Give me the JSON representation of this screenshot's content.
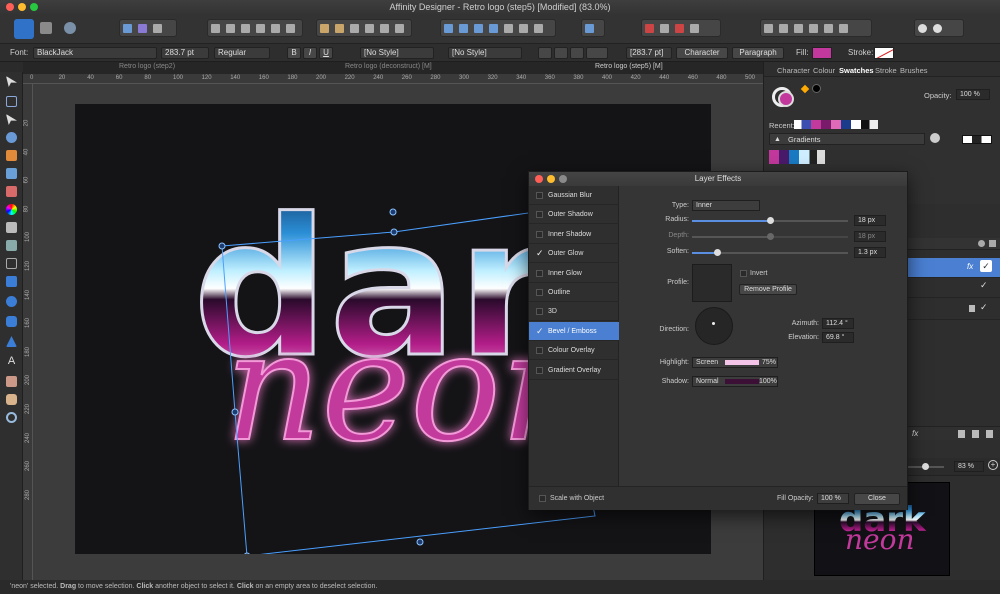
{
  "app": {
    "title": "Affinity Designer - Retro logo (step5) [Modified] (83.0%)"
  },
  "context_toolbar": {
    "font_label": "Font:",
    "font_name": "BlackJack",
    "font_size": "283.7 pt",
    "font_style": "Regular",
    "bold": "B",
    "italic": "I",
    "underline": "U",
    "char_style": "[No Style]",
    "para_style": "[No Style]",
    "size2": "[283.7 pt]",
    "character_button": "Character",
    "paragraph_button": "Paragraph",
    "fill_label": "Fill:",
    "stroke_label": "Stroke:",
    "fill_color": "#c2389c"
  },
  "doc_tabs": [
    "Retro logo (step2)",
    "Retro logo (deconstruct) [M]",
    "Retro logo (step5) [M]"
  ],
  "ruler_top": [
    "0",
    "20",
    "40",
    "60",
    "80",
    "100",
    "120",
    "140",
    "160",
    "180",
    "200",
    "220",
    "240",
    "260",
    "280",
    "300",
    "320",
    "340",
    "360",
    "380",
    "400",
    "420",
    "440",
    "460",
    "480",
    "500",
    "520",
    "540"
  ],
  "ruler_left": [
    "20",
    "40",
    "60",
    "80",
    "100",
    "120",
    "140",
    "160",
    "180",
    "200",
    "220",
    "240",
    "260",
    "280"
  ],
  "panel": {
    "tabs": [
      "Character",
      "Colour",
      "Swatches",
      "Stroke",
      "Brushes"
    ],
    "active_tab": "Swatches",
    "opacity_label": "Opacity:",
    "opacity_value": "100 %",
    "recent_label": "Recent:",
    "gradients_label": "Gradients"
  },
  "dialog": {
    "title": "Layer Effects",
    "effects": [
      {
        "label": "Gaussian Blur",
        "checked": false,
        "selected": false
      },
      {
        "label": "Outer Shadow",
        "checked": false,
        "selected": false
      },
      {
        "label": "Inner Shadow",
        "checked": false,
        "selected": false
      },
      {
        "label": "Outer Glow",
        "checked": true,
        "selected": false
      },
      {
        "label": "Inner Glow",
        "checked": false,
        "selected": false
      },
      {
        "label": "Outline",
        "checked": false,
        "selected": false
      },
      {
        "label": "3D",
        "checked": false,
        "selected": false
      },
      {
        "label": "Bevel / Emboss",
        "checked": true,
        "selected": true
      },
      {
        "label": "Colour Overlay",
        "checked": false,
        "selected": false
      },
      {
        "label": "Gradient Overlay",
        "checked": false,
        "selected": false
      }
    ],
    "type_label": "Type:",
    "type_value": "Inner",
    "radius_label": "Radius:",
    "radius_value": "18 px",
    "radius_fraction": 0.5,
    "depth_label": "Depth:",
    "depth_value": "18 px",
    "depth_fraction": 0.5,
    "soften_label": "Soften:",
    "soften_value": "1.3 px",
    "soften_fraction": 0.16,
    "profile_label": "Profile:",
    "invert_label": "Invert",
    "remove_profile": "Remove Profile",
    "direction_label": "Direction:",
    "azimuth_label": "Azimuth:",
    "azimuth_value": "112.4 °",
    "elevation_label": "Elevation:",
    "elevation_value": "69.8 °",
    "highlight_label": "Highlight:",
    "highlight_mode": "Screen",
    "highlight_pct": "75%",
    "highlight_color": "#f3c3e8",
    "shadow_label": "Shadow:",
    "shadow_mode": "Normal",
    "shadow_pct": "100%",
    "shadow_color": "#3c0f36",
    "scale_label": "Scale with Object",
    "fill_opacity_label": "Fill Opacity:",
    "fill_opacity_value": "100 %",
    "close_button": "Close"
  },
  "navigator": {
    "zoom": "83 %"
  },
  "art": {
    "word1": "dark",
    "word2": "neon"
  },
  "status": {
    "prefix": "'neon' selected. ",
    "b1": "Drag",
    "t1": " to move selection. ",
    "b2": "Click",
    "t2": " another object to select it. ",
    "b3": "Click",
    "t3": " on an empty area to deselect selection."
  }
}
